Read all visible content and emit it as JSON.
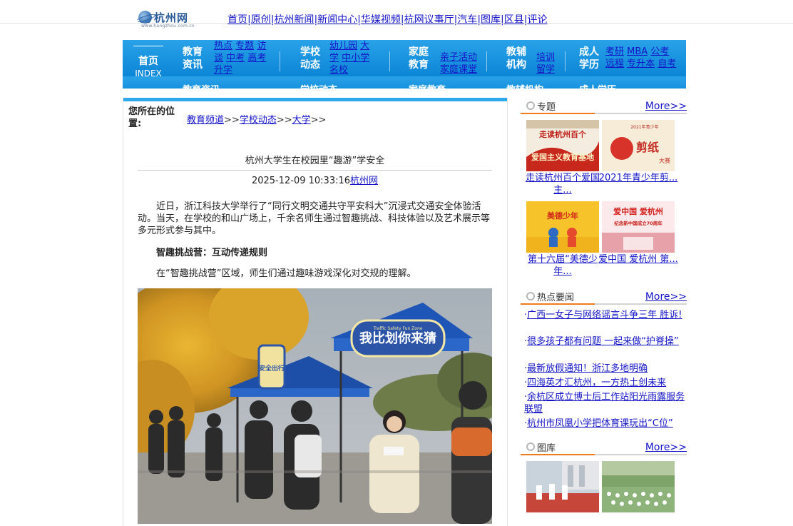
{
  "logo": {
    "name": "杭州网",
    "domain": "www.hangzhou.com.cn"
  },
  "topnav": [
    "首页",
    "原创",
    "杭州新闻",
    "新闻中心",
    "华媒视频",
    "杭网议事厅",
    "汽车",
    "图库",
    "区县",
    "评论"
  ],
  "topnav_sep": "|",
  "channel_nav": {
    "home": {
      "title": "首页",
      "sub": "INDEX"
    },
    "groups": [
      {
        "title": "教育资讯",
        "links": [
          "热点",
          "专题",
          "访谈",
          "中考",
          "高考",
          "升学"
        ]
      },
      {
        "title": "学校动态",
        "links": [
          "幼儿园",
          "大学",
          "中小学",
          "名校"
        ]
      },
      {
        "title": "家庭教育",
        "links": [
          "亲子活动",
          "家庭课堂"
        ]
      },
      {
        "title": "教辅机构",
        "links": [
          "培训",
          "留学"
        ]
      },
      {
        "title": "成人学历",
        "links": [
          "考研",
          "MBA",
          "公考",
          "远程",
          "专升本",
          "自考"
        ]
      }
    ]
  },
  "breadcrumb": {
    "label": "您所在的位置:",
    "items": [
      "教育频道",
      "学校动态",
      "大学"
    ],
    "sep": ">>"
  },
  "article": {
    "title": "杭州大学生在校园里“趣游”学安全",
    "datetime": "2025-12-09 10:33:16",
    "source": "杭州网",
    "para1": "近日，浙江科技大学举行了“同行文明交通共守平安科大”沉浸式交通安全体验活动。当天，在学校的和山广场上，千余名师生通过智趣挑战、科技体验以及艺术展示等多元形式参与其中。",
    "subhead": "智趣挑战营：互动传递规则",
    "para2": "在“智趣挑战营”区域，师生们通过趣味游戏深化对交规的理解。",
    "photo_banner": "我比划你来猜",
    "photo_banner_small": "Traffic Safety Fun Zone",
    "photo_banner2": "安全出行"
  },
  "sidebar": {
    "special": {
      "title": "专题",
      "more": "More>>",
      "items": [
        {
          "caption": "走读杭州百个爱国主...",
          "thumb_text": "走读杭州百个",
          "thumb_text2": "爱国主义教育基地"
        },
        {
          "caption": "2021年青少年剪...",
          "thumb_text": "剪纸",
          "thumb_text2": "大赛",
          "thumb_top": "2021年青少年"
        },
        {
          "caption": "第十六届“美德少年...",
          "thumb_text": "美德少年"
        },
        {
          "caption": "爱中国 爱杭州 第...",
          "thumb_text": "爱中国 爱杭州",
          "thumb_text2": "纪念新中国成立70周年"
        }
      ]
    },
    "hot": {
      "title": "热点要闻",
      "more": "More>>",
      "items": [
        "广西一女子与网络谣言斗争三年 胜诉!",
        "很多孩子都有问题 一起来做“护脊操”",
        "最新放假通知！浙江多地明确",
        "四海英才汇杭州，一方热土创未来",
        "余杭区成立博士后工作站阳光雨露服务联盟",
        "杭州市凤凰小学把体育课玩出“C位”"
      ],
      "bullet": "·"
    },
    "gallery": {
      "title": "图库",
      "more": "More>>"
    }
  }
}
